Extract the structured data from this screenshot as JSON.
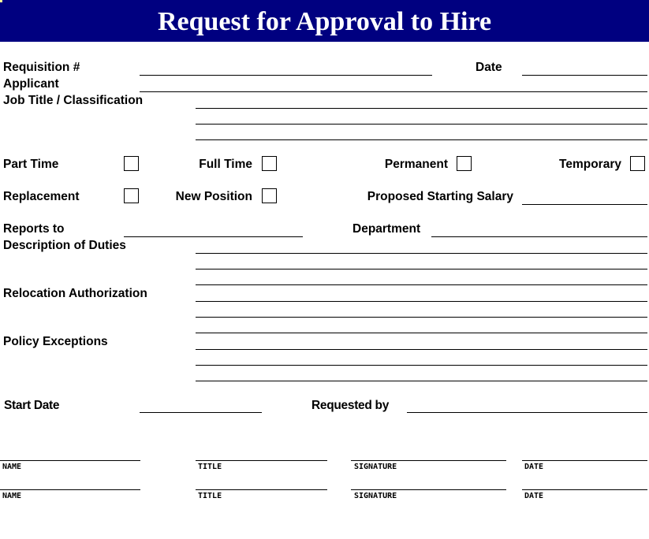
{
  "header": {
    "title": "Request for Approval to Hire",
    "background": "#000080"
  },
  "fields": {
    "requisition": "Requisition #",
    "date": "Date",
    "applicant": "Applicant",
    "job_title": "Job Title / Classification",
    "part_time": "Part Time",
    "full_time": "Full Time",
    "permanent": "Permanent",
    "temporary": "Temporary",
    "replacement": "Replacement",
    "new_position": "New Position",
    "proposed_salary": "Proposed Starting Salary",
    "reports_to": "Reports to",
    "department": "Department",
    "description": "Description of Duties",
    "relocation": "Relocation Authorization",
    "policy": "Policy Exceptions",
    "start_date": "Start Date",
    "requested_by": "Requested by"
  },
  "signatures": {
    "name": "NAME",
    "title": "TITLE",
    "signature": "SIGNATURE",
    "date": "DATE"
  }
}
